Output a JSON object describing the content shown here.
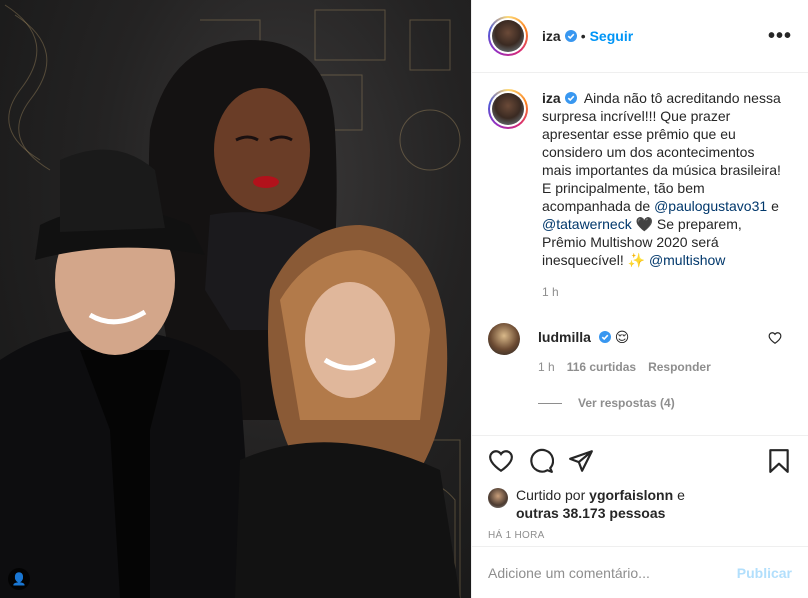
{
  "post": {
    "username": "iza",
    "follow_label": "Seguir",
    "dot": "•",
    "more_label": "•••"
  },
  "caption": {
    "username": "iza",
    "text_1": "Ainda não tô acreditando nessa surpresa incrível!!! Que prazer apresentar esse prêmio que eu considero um dos acontecimentos mais importantes da música brasileira! E principalmente, tão bem acompanhada de",
    "mention_1": "@paulogustavo31",
    "text_2": "e",
    "mention_2": "@tatawerneck",
    "heart": "🖤",
    "text_3": "Se preparem, Prêmio Multishow 2020 será inesquecível!",
    "sparkle": "✨",
    "mention_3": "@multishow",
    "time": "1 h"
  },
  "reply": {
    "username": "ludmilla",
    "text": "😌",
    "time": "1 h",
    "likes": "116 curtidas",
    "reply_label": "Responder",
    "view_replies": "Ver respostas (4)"
  },
  "likes": {
    "prefix": "Curtido por",
    "user": "ygorfaislonn",
    "mid": "e",
    "others": "outras 38.173 pessoas",
    "timestamp": "HÁ 1 HORA"
  },
  "comment_box": {
    "placeholder": "Adicione um comentário...",
    "publish_label": "Publicar"
  },
  "colors": {
    "link": "#0095f6",
    "mention": "#00376b",
    "muted": "#8e8e8e",
    "publish_disabled": "#b2dffc"
  },
  "icons": {
    "like": "heart-icon",
    "comment": "comment-icon",
    "share": "share-icon",
    "save": "bookmark-icon",
    "verified": "verified-badge-icon",
    "tag": "user-tag-icon"
  }
}
